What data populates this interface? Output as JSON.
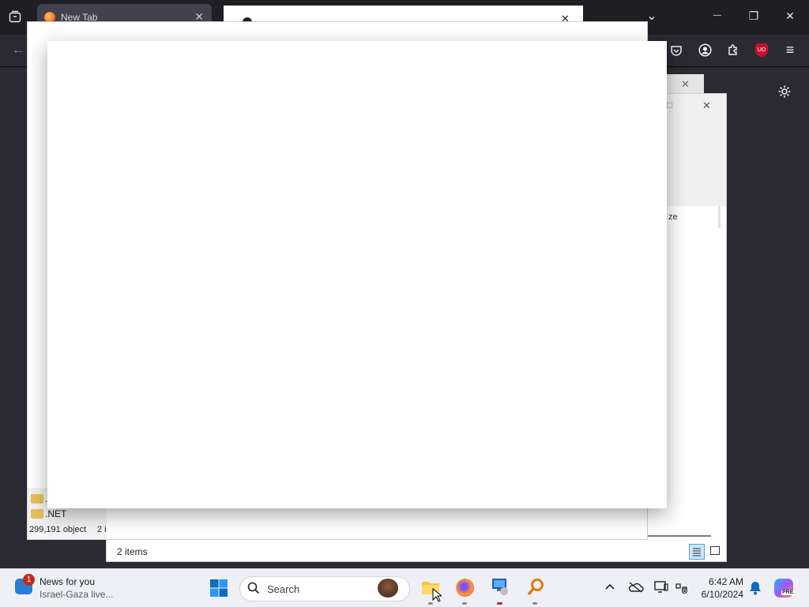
{
  "firefox": {
    "tab_title": "New Tab",
    "tab_close": "✕",
    "toolbar_icons": {
      "back": "←",
      "pocket": "pocket-icon",
      "account": "account-icon",
      "extensions": "extensions-icon",
      "ublock": "UO",
      "menu": "≡"
    },
    "settings_icon": "⚙"
  },
  "window_controls": {
    "list_tabs": "⌄",
    "minimize": "—",
    "restore": "❐",
    "close": "✕"
  },
  "dialogs": {
    "top_close": "✕",
    "mid_close": "✕",
    "right_close": "✕",
    "right_restore": "□",
    "partial_column": "ze"
  },
  "explorer_left": {
    "folders": [
      ".",
      ".NET"
    ],
    "status": "299,191 object",
    "status_partial": "2 i"
  },
  "explorer_main": {
    "status": "2 items"
  },
  "taskbar": {
    "news_badge": "1",
    "news_title": "News for you",
    "news_subtitle": "Israel-Gaza live...",
    "search_label": "Search",
    "clock_time": "6:42 AM",
    "clock_date": "6/10/2024",
    "copilot_badge": "PRE"
  },
  "colors": {
    "firefox_bg": "#1f1e23",
    "firefox_toolbar": "#2b2a33",
    "taskbar_bg": "#eef0f5",
    "accent_blue": "#0067c0",
    "ublock_red": "#c8102e"
  }
}
